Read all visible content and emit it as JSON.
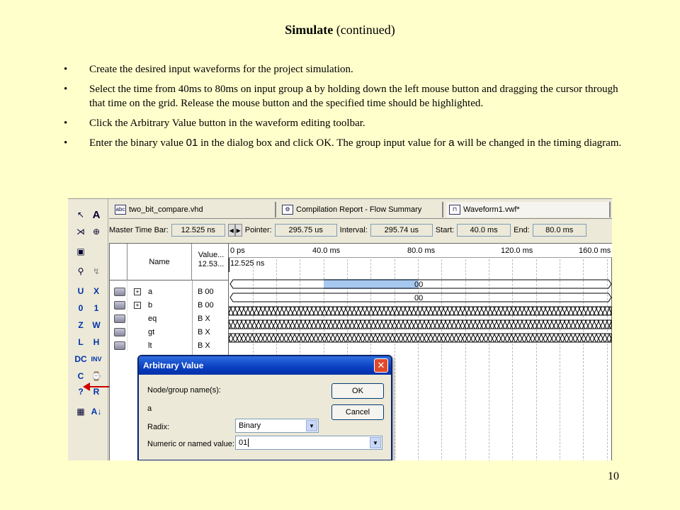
{
  "slide": {
    "title_bold": "Simulate",
    "title_rest": " (continued)",
    "page_number": "10",
    "bullets": [
      {
        "parts": [
          "Create the desired input waveforms for the project simulation."
        ]
      },
      {
        "parts": [
          "Select the time from 40ms to 80ms on input group ",
          "a",
          " by holding down the left mouse button and dragging the cursor through that time on the grid.  Release the mouse button and the specified time should be highlighted."
        ]
      },
      {
        "parts": [
          "Click the Arbitrary Value button in the waveform editing toolbar."
        ]
      },
      {
        "parts": [
          "Enter the binary value ",
          "01",
          " in the dialog box and click OK.  The group input value for ",
          "a",
          " will be changed in the timing diagram."
        ]
      }
    ]
  },
  "tabs": [
    {
      "icon": "abc",
      "label": "two_bit_compare.vhd"
    },
    {
      "icon": "",
      "label": "Compilation Report - Flow Summary"
    },
    {
      "icon": "",
      "label": "Waveform1.vwf*"
    }
  ],
  "infobar": {
    "master_label": "Master Time Bar:",
    "master_value": "12.525 ns",
    "pointer_label": "Pointer:",
    "pointer_value": "295.75 us",
    "interval_label": "Interval:",
    "interval_value": "295.74 us",
    "start_label": "Start:",
    "start_value": "40.0 ms",
    "end_label": "End:",
    "end_value": "80.0 ms"
  },
  "nodes": {
    "header_name": "Name",
    "header_value": "Value...",
    "header_value2": "12.53...",
    "rows": [
      {
        "name": "a",
        "value": "B 00",
        "group": true
      },
      {
        "name": "b",
        "value": "B 00",
        "group": true
      },
      {
        "name": "eq",
        "value": "B X",
        "group": false
      },
      {
        "name": "gt",
        "value": "B X",
        "group": false
      },
      {
        "name": "lt",
        "value": "B X",
        "group": false
      }
    ]
  },
  "waveform": {
    "ticks": [
      "0 ps",
      "40.0 ms",
      "80.0 ms",
      "120.0 ms",
      "160.0 ms"
    ],
    "master_marker": "12.525 ns",
    "bus_a_value": "00",
    "bus_b_value": "00"
  },
  "dialog": {
    "title": "Arbitrary Value",
    "close": "✕",
    "node_label": "Node/group name(s):",
    "node_value": "a",
    "radix_label": "Radix:",
    "radix_value": "Binary",
    "value_label": "Numeric or named value:",
    "value_value": "01",
    "ok_label": "OK",
    "cancel_label": "Cancel"
  },
  "colors": {
    "slide_bg": "#ffffcc",
    "selection": "#a6c8f0",
    "dialog_title": "#0a3fc0"
  }
}
